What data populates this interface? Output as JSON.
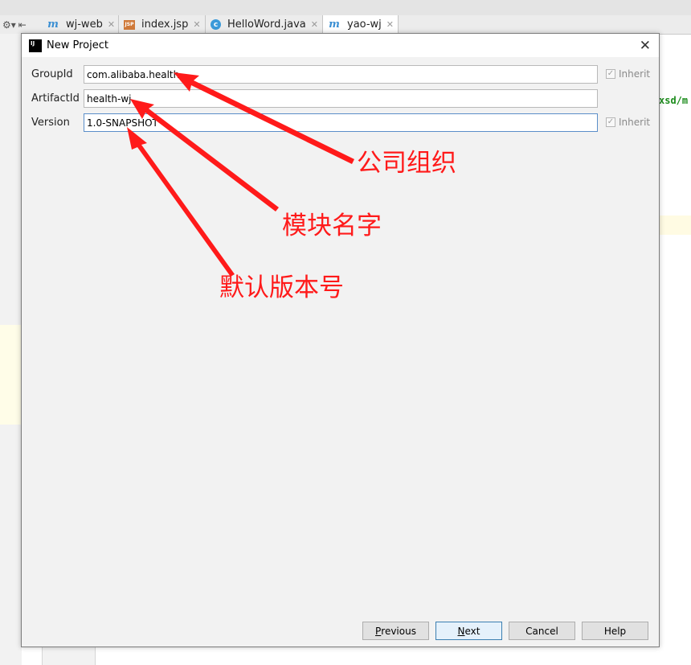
{
  "ide": {
    "tabs": [
      {
        "label": "wj-web",
        "icon": "maven-icon"
      },
      {
        "label": "index.jsp",
        "icon": "jsp-file-icon"
      },
      {
        "label": "HelloWord.java",
        "icon": "java-class-icon"
      },
      {
        "label": "yao-wj",
        "icon": "maven-icon"
      }
    ],
    "right_code_fragment": "xsd/m"
  },
  "dialog": {
    "title": "New Project",
    "fields": {
      "group_id": {
        "label": "GroupId",
        "value": "com.alibaba.health"
      },
      "artifact_id": {
        "label": "ArtifactId",
        "value": "health-wj"
      },
      "version": {
        "label": "Version",
        "value": "1.0-SNAPSHOT"
      }
    },
    "inherit_label": "Inherit",
    "buttons": {
      "previous": {
        "mnemonic": "P",
        "rest": "revious"
      },
      "next": {
        "mnemonic": "N",
        "rest": "ext"
      },
      "cancel": "Cancel",
      "help": "Help"
    }
  },
  "annotations": {
    "group_id": "公司组织",
    "artifact_id": "模块名字",
    "version": "默认版本号"
  },
  "colors": {
    "annotation": "#ff1a1a",
    "focus_border": "#5b8ec9",
    "primary_button_border": "#3c7fb1"
  }
}
